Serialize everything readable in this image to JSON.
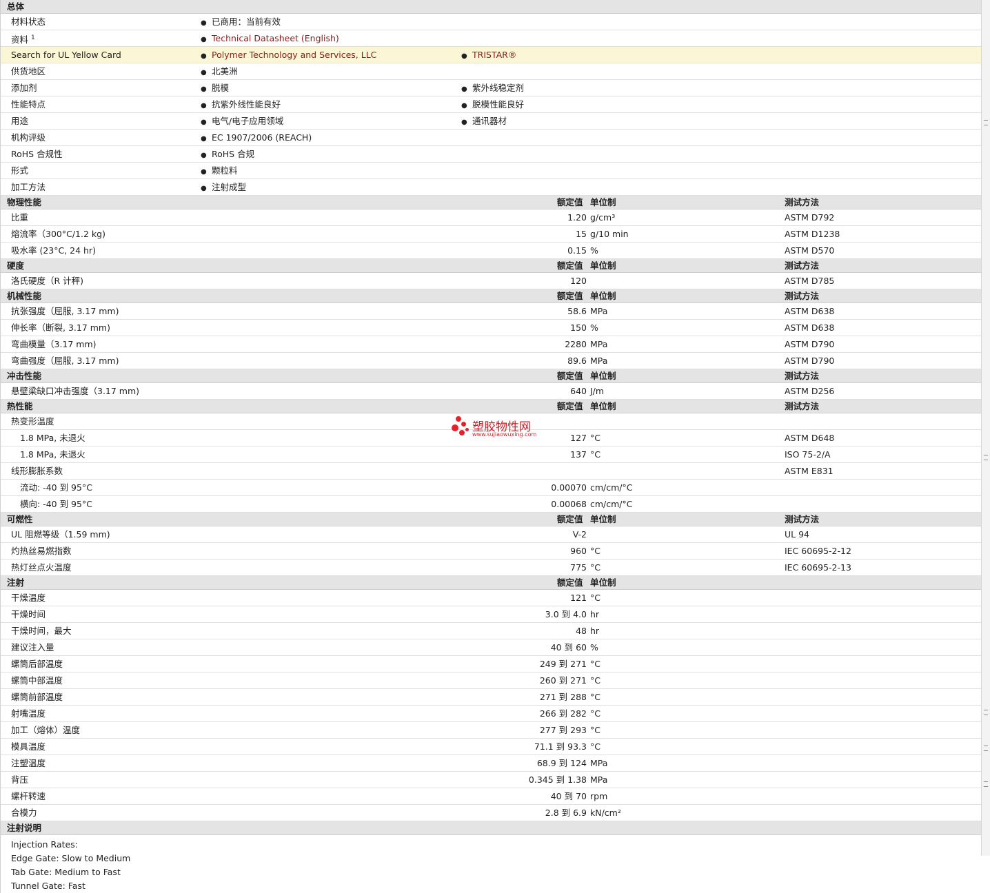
{
  "general": {
    "title": "总体",
    "rows": [
      {
        "label": "材料状态",
        "b1": "已商用：当前有效"
      },
      {
        "label": "资料",
        "sup": "1",
        "b1": "Technical Datasheet (English)"
      },
      {
        "label": "Search for UL Yellow Card",
        "b1": "Polymer Technology and Services, LLC",
        "b2": "TRISTAR®"
      },
      {
        "label": "供货地区",
        "b1": "北美洲"
      },
      {
        "label": "添加剂",
        "b1": "脱模",
        "b2": "紫外线稳定剂"
      },
      {
        "label": "性能特点",
        "b1": "抗紫外线性能良好",
        "b2": "脱模性能良好"
      },
      {
        "label": "用途",
        "b1": "电气/电子应用领域",
        "b2": "通讯器材"
      },
      {
        "label": "机构评级",
        "b1": "EC 1907/2006 (REACH)"
      },
      {
        "label": "RoHS 合规性",
        "b1": "RoHS 合规"
      },
      {
        "label": "形式",
        "b1": "颗粒料"
      },
      {
        "label": "加工方法",
        "b1": "注射成型"
      }
    ]
  },
  "headers": {
    "value": "额定值",
    "unit": "单位制",
    "test": "测试方法"
  },
  "physical": {
    "title": "物理性能",
    "rows": [
      {
        "label": "比重",
        "value": "1.20",
        "unit": "g/cm³",
        "test": "ASTM D792"
      },
      {
        "label": "熔流率（300°C/1.2 kg)",
        "value": "15",
        "unit": "g/10 min",
        "test": "ASTM D1238"
      },
      {
        "label": "吸水率 (23°C, 24 hr)",
        "value": "0.15",
        "unit": "%",
        "test": "ASTM D570"
      }
    ]
  },
  "hardness": {
    "title": "硬度",
    "rows": [
      {
        "label": "洛氏硬度（R 计秤)",
        "value": "120",
        "unit": "",
        "test": "ASTM D785"
      }
    ]
  },
  "mechanical": {
    "title": "机械性能",
    "rows": [
      {
        "label": "抗张强度（屈服, 3.17 mm)",
        "value": "58.6",
        "unit": "MPa",
        "test": "ASTM D638"
      },
      {
        "label": "伸长率（断裂, 3.17 mm)",
        "value": "150",
        "unit": "%",
        "test": "ASTM D638"
      },
      {
        "label": "弯曲模量（3.17 mm)",
        "value": "2280",
        "unit": "MPa",
        "test": "ASTM D790"
      },
      {
        "label": "弯曲强度（屈服, 3.17 mm)",
        "value": "89.6",
        "unit": "MPa",
        "test": "ASTM D790"
      }
    ]
  },
  "impact": {
    "title": "冲击性能",
    "rows": [
      {
        "label": "悬壁梁缺口冲击强度（3.17 mm)",
        "value": "640",
        "unit": "J/m",
        "test": "ASTM D256"
      }
    ]
  },
  "thermal": {
    "title": "热性能",
    "rows": [
      {
        "label": "热变形温度",
        "value": "",
        "unit": "",
        "test": ""
      },
      {
        "label": "1.8 MPa, 未退火",
        "indent": true,
        "value": "127",
        "unit": "°C",
        "test": "ASTM D648"
      },
      {
        "label": "1.8 MPa, 未退火",
        "indent": true,
        "value": "137",
        "unit": "°C",
        "test": "ISO 75-2/A"
      },
      {
        "label": "线形膨胀系数",
        "value": "",
        "unit": "",
        "test": "ASTM E831"
      },
      {
        "label": "流动: -40 到  95°C",
        "indent": true,
        "value": "0.00070",
        "unit": "cm/cm/°C",
        "test": ""
      },
      {
        "label": "横向: -40 到  95°C",
        "indent": true,
        "value": "0.00068",
        "unit": "cm/cm/°C",
        "test": ""
      }
    ]
  },
  "flammability": {
    "title": "可燃性",
    "rows": [
      {
        "label": "UL 阻燃等级（1.59 mm)",
        "value": "V-2",
        "unit": "",
        "test": "UL 94"
      },
      {
        "label": "灼热丝易燃指数",
        "value": "960",
        "unit": "°C",
        "test": "IEC 60695-2-12"
      },
      {
        "label": "热灯丝点火温度",
        "value": "775",
        "unit": "°C",
        "test": "IEC 60695-2-13"
      }
    ]
  },
  "injection": {
    "title": "注射",
    "rows": [
      {
        "label": "干燥温度",
        "value": "121",
        "unit": "°C"
      },
      {
        "label": "干燥时间",
        "value": "3.0 到  4.0",
        "unit": "hr"
      },
      {
        "label": "干燥时间，最大",
        "value": "48",
        "unit": "hr"
      },
      {
        "label": "建议注入量",
        "value": "40 到  60",
        "unit": "%"
      },
      {
        "label": "螺筒后部温度",
        "value": "249 到  271",
        "unit": "°C"
      },
      {
        "label": "螺筒中部温度",
        "value": "260 到  271",
        "unit": "°C"
      },
      {
        "label": "螺筒前部温度",
        "value": "271 到  288",
        "unit": "°C"
      },
      {
        "label": "射嘴温度",
        "value": "266 到  282",
        "unit": "°C"
      },
      {
        "label": "加工（熔体）温度",
        "value": "277 到  293",
        "unit": "°C"
      },
      {
        "label": "模具温度",
        "value": "71.1 到  93.3",
        "unit": "°C"
      },
      {
        "label": "注塑温度",
        "value": "68.9 到  124",
        "unit": "MPa"
      },
      {
        "label": "背压",
        "value": "0.345 到  1.38",
        "unit": "MPa"
      },
      {
        "label": "螺杆转速",
        "value": "40 到  70",
        "unit": "rpm"
      },
      {
        "label": "合模力",
        "value": "2.8 到  6.9",
        "unit": "kN/cm²"
      }
    ]
  },
  "injection_notes": {
    "title": "注射说明",
    "lines": [
      "Injection Rates:",
      "Edge Gate: Slow to Medium",
      "Tab Gate: Medium to Fast",
      "Tunnel Gate: Fast"
    ]
  },
  "watermark": {
    "name": "塑胶物性网",
    "url": "www.sujiaowuxing.com",
    "color": "#e8202a"
  }
}
